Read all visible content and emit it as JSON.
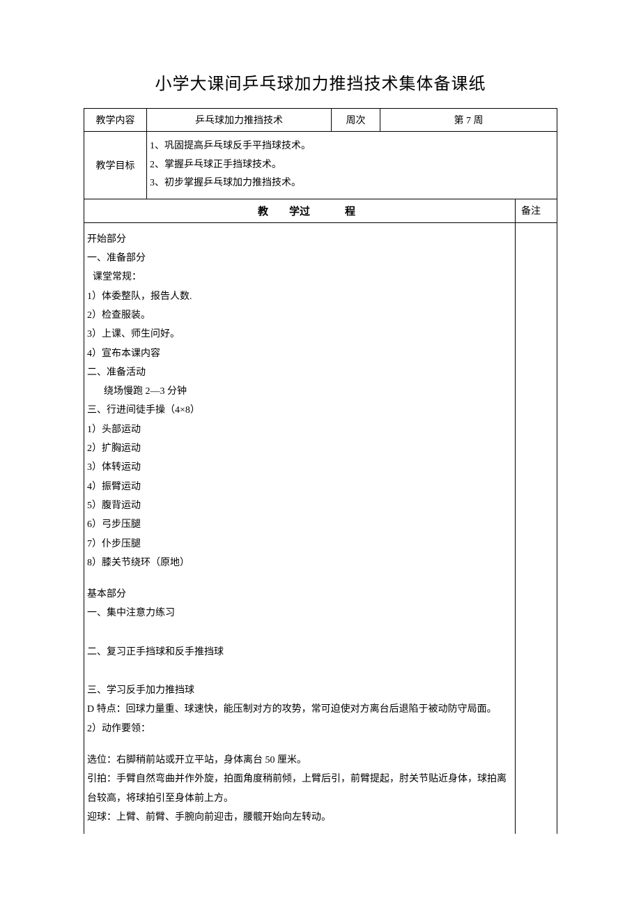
{
  "title": "小学大课间乒乓球加力推挡技术集体备课纸",
  "row1": {
    "label1": "教学内容",
    "content": "乒乓球加力推挡技术",
    "label2": "周次",
    "week": "第 7 周"
  },
  "row2": {
    "label": "教学目标",
    "goal1": "1、巩固提高乒乓球反手平挡球技术。",
    "goal2": "2、掌握乒乓球正手挡球技术。",
    "goal3": "3、初步掌握乒乓球加力推挡技术。"
  },
  "processHeader": {
    "jiao": "教",
    "xueguo": "学过",
    "cheng": "程",
    "remark": "备注"
  },
  "body": {
    "p1": "开始部分",
    "p2": "一、准备部分",
    "p3": "课堂常规：",
    "p4": "1）体委整队，报告人数.",
    "p5": "2）检查服装。",
    "p6": "3）上课、师生问好。",
    "p7": "4）宣布本课内容",
    "p8": "二、准备活动",
    "p9": "绕场慢跑 2—3 分钟",
    "p10": "三、行进间徒手操（4×8）",
    "p11": "1）头部运动",
    "p12": "2）扩胸运动",
    "p13": "3）体转运动",
    "p14": "4）振臂运动",
    "p15": "5）腹背运动",
    "p16": "6）弓步压腿",
    "p17": "7）仆步压腿",
    "p18": "8）膝关节绕环（原地）",
    "p19": "基本部分",
    "p20": "一、集中注意力练习",
    "p21": "二、复习正手挡球和反手推挡球",
    "p22": "三、学习反手加力推挡球",
    "p23": "D 特点：回球力量重、球速快，能压制对方的攻势，常可迫使对方离台后退陷于被动防守局面。",
    "p24": "2）动作要领：",
    "p25": "选位：右脚稍前站或开立平站，身体离台 50 厘米。",
    "p26": "引拍：手臂自然弯曲并作外旋，拍面角度稍前倾，上臂后引，前臂提起，肘关节贴近身体，球拍离台较高，将球拍引至身体前上方。",
    "p27": "迎球：上臂、前臂、手腕向前迎击，腰髋开始向左转动。"
  }
}
